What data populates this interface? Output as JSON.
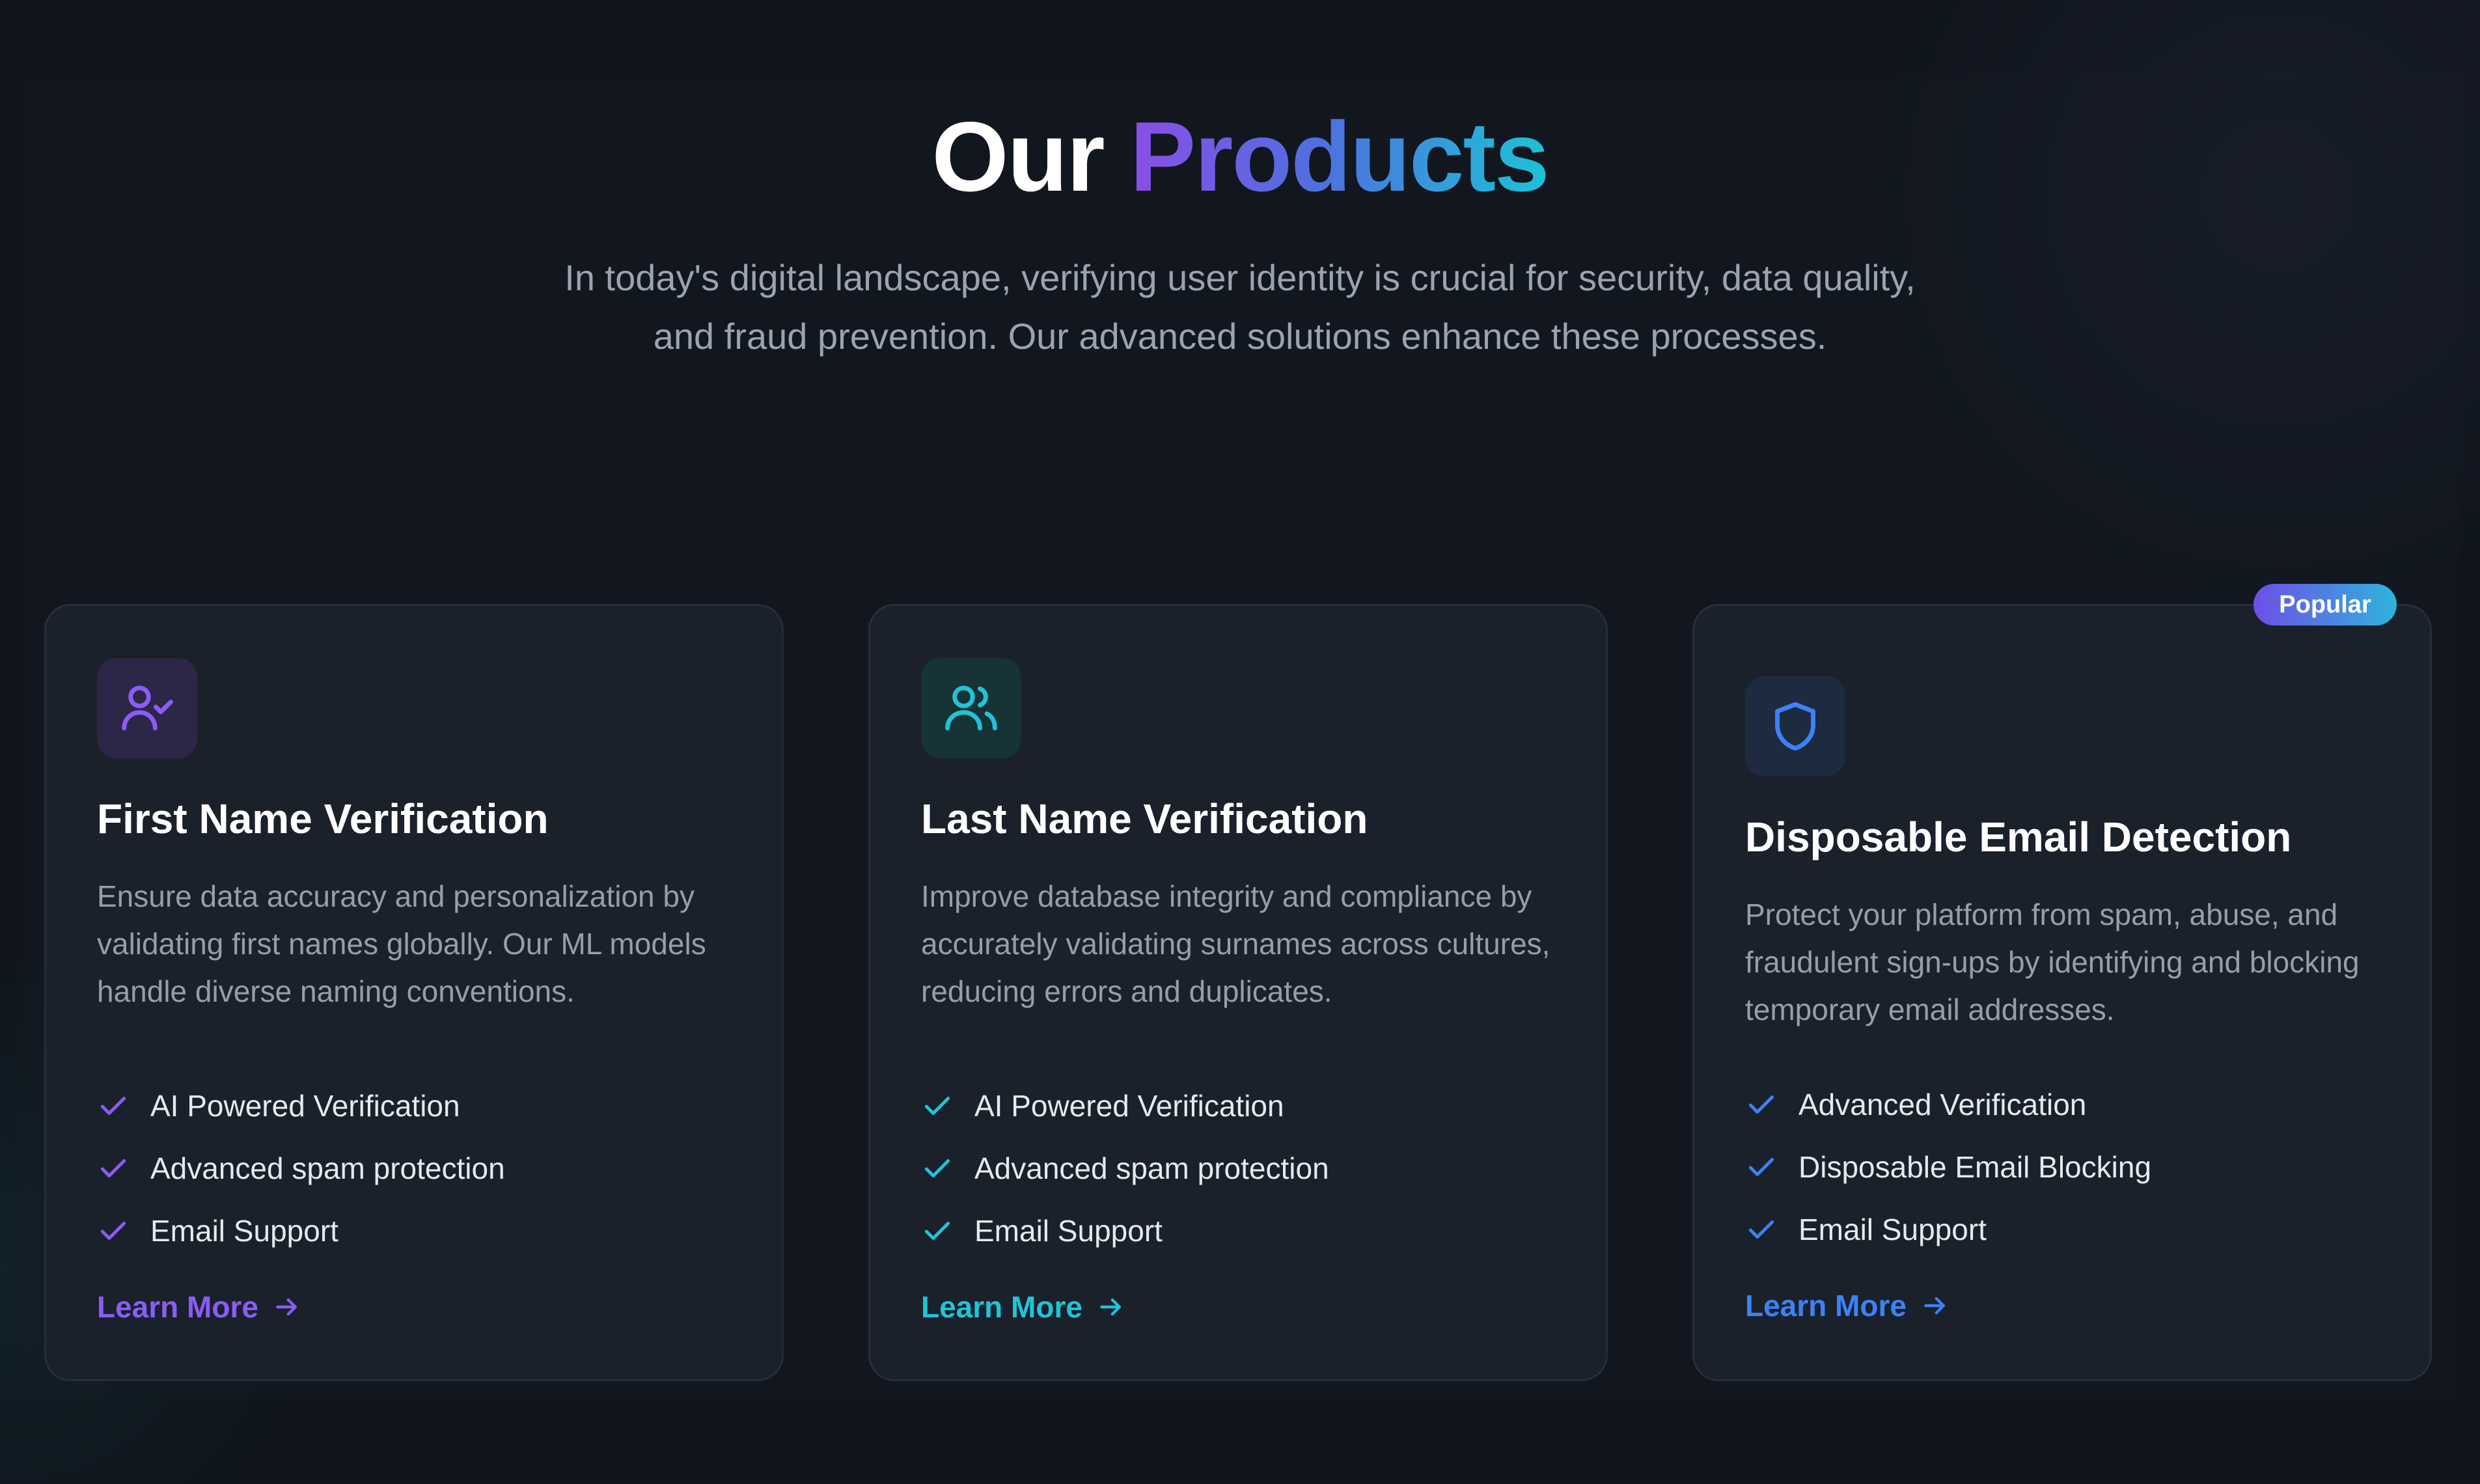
{
  "header": {
    "title_plain": "Our",
    "title_highlight": "Products",
    "subtitle": "In today's digital landscape, verifying user identity is crucial for security, data quality, and fraud prevention. Our advanced solutions enhance these processes."
  },
  "colors": {
    "background": "#10151d",
    "card_background": "#1a212b",
    "purple_accent": "#8b5cf6",
    "teal_accent": "#22c3d6",
    "blue_accent": "#3b82f6"
  },
  "cards": [
    {
      "icon": "user-check-icon",
      "title": "First Name Verification",
      "description": "Ensure data accuracy and personalization by validating first names globally. Our ML models handle diverse naming conventions.",
      "features": [
        "AI Powered Verification",
        "Advanced spam protection",
        "Email Support"
      ],
      "link_label": "Learn More",
      "accent": "purple"
    },
    {
      "icon": "users-icon",
      "title": "Last Name Verification",
      "description": "Improve database integrity and compliance by accurately validating surnames across cultures, reducing errors and duplicates.",
      "features": [
        "AI Powered Verification",
        "Advanced spam protection",
        "Email Support"
      ],
      "link_label": "Learn More",
      "accent": "teal"
    },
    {
      "icon": "shield-icon",
      "title": "Disposable Email Detection",
      "description": "Protect your platform from spam, abuse, and fraudulent sign-ups by identifying and blocking temporary email addresses.",
      "features": [
        "Advanced Verification",
        "Disposable Email Blocking",
        "Email Support"
      ],
      "link_label": "Learn More",
      "accent": "blue",
      "badge": "Popular"
    }
  ]
}
